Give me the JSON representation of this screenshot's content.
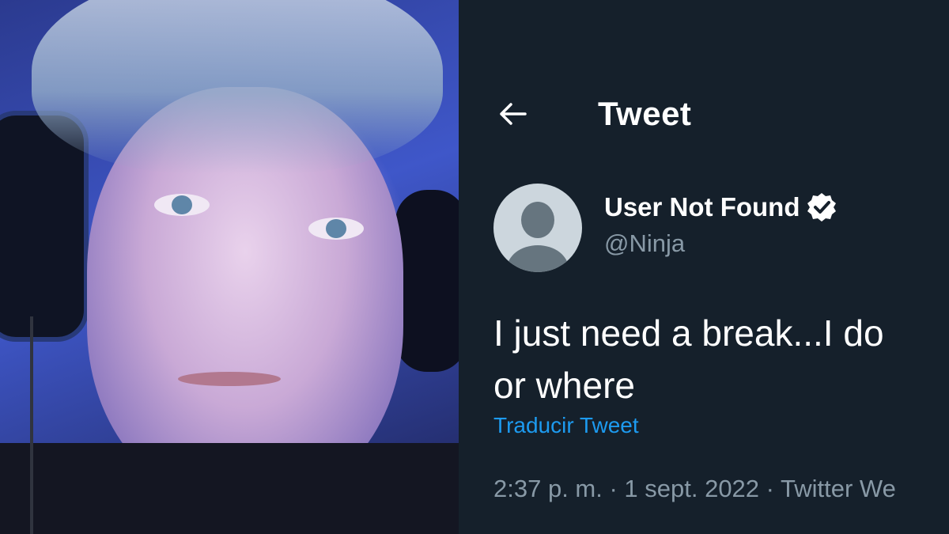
{
  "header": {
    "back_icon": "arrow-left-icon",
    "title": "Tweet"
  },
  "author": {
    "display_name": "User Not Found",
    "verified_icon": "verified-badge-icon",
    "handle": "@Ninja",
    "avatar_icon": "default-avatar-icon"
  },
  "tweet": {
    "text_line_1": "I just need a break...I do",
    "text_line_2": "or where",
    "translate_label": "Traducir Tweet",
    "meta": "2:37 p. m. · 1 sept. 2022 · Twitter We"
  },
  "colors": {
    "background": "#15202b",
    "secondary_text": "#8899a6",
    "link": "#1d9bf0"
  }
}
